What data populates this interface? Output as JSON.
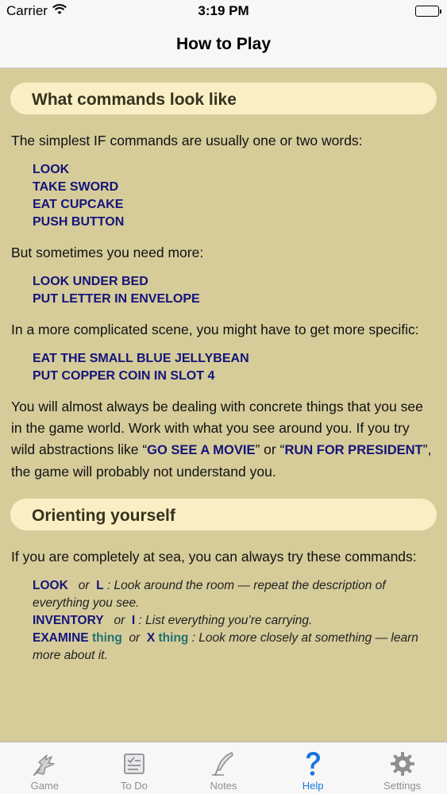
{
  "status": {
    "carrier": "Carrier",
    "time": "3:19 PM"
  },
  "nav": {
    "title": "How to Play"
  },
  "sections": {
    "s1": {
      "header": "What commands look like",
      "p1": "The simplest IF commands are usually one or two words:",
      "cmds1": [
        "LOOK",
        "TAKE SWORD",
        "EAT CUPCAKE",
        "PUSH BUTTON"
      ],
      "p2": "But sometimes you need more:",
      "cmds2": [
        "LOOK UNDER BED",
        "PUT LETTER IN ENVELOPE"
      ],
      "p3": "In a more complicated scene, you might have to get more specific:",
      "cmds3": [
        "EAT THE SMALL BLUE JELLYBEAN",
        "PUT COPPER COIN IN SLOT 4"
      ],
      "p4_a": "You will almost always be dealing with concrete things that you see in the game world. Work with what you see around you. If you try wild abstractions like “",
      "p4_cmd1": "GO SEE A MOVIE",
      "p4_b": "” or “",
      "p4_cmd2": "RUN FOR PRESIDENT",
      "p4_c": "”, the game will probably not understand you."
    },
    "s2": {
      "header": "Orienting yourself",
      "p1": "If you are completely at sea, you can always try these commands:",
      "refs": {
        "look": {
          "kw": "LOOK",
          "or": "or",
          "alt": "L",
          "desc": " : Look around the room — repeat the description of everything you see."
        },
        "inventory": {
          "kw": "INVENTORY",
          "or": "or",
          "alt": "I",
          "desc": " : List everything you’re carrying."
        },
        "examine": {
          "kw": "EXAMINE",
          "arg": "thing",
          "or": "or",
          "alt": "X",
          "arg2": "thing",
          "desc": " : Look more closely at something — learn more about it."
        }
      }
    }
  },
  "tabs": [
    {
      "label": "Game",
      "icon": "game-icon",
      "active": false
    },
    {
      "label": "To Do",
      "icon": "todo-icon",
      "active": false
    },
    {
      "label": "Notes",
      "icon": "quill-icon",
      "active": false
    },
    {
      "label": "Help",
      "icon": "question-icon",
      "active": true
    },
    {
      "label": "Settings",
      "icon": "gear-icon",
      "active": false
    }
  ],
  "colors": {
    "background": "#d6cc9a",
    "header_pill": "#f8efc4",
    "command": "#14147a",
    "argument": "#237070",
    "active_tab": "#1a75e0",
    "inactive_tab": "#8e8e93"
  }
}
